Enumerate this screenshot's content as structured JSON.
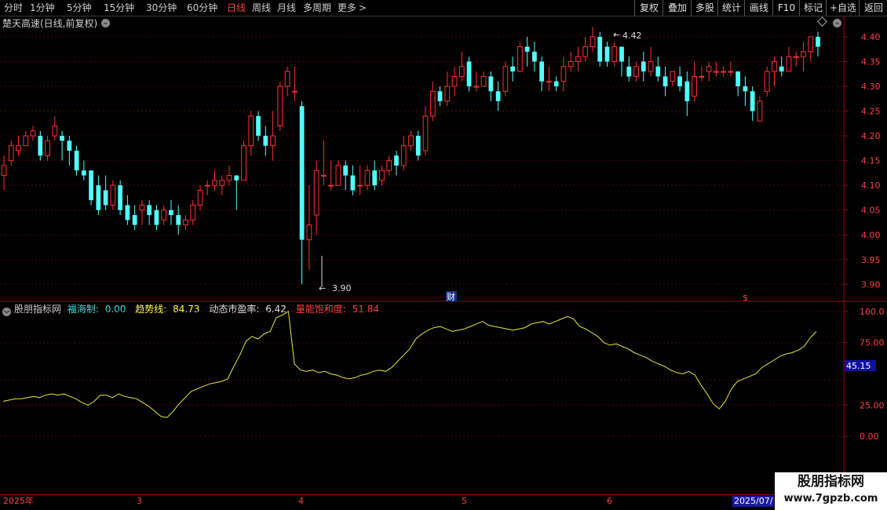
{
  "toolbar": {
    "timeframes": [
      "分时",
      "1分钟",
      "5分钟",
      "15分钟",
      "30分钟",
      "60分钟",
      "日线",
      "周线",
      "月线",
      "多周期",
      "更多"
    ],
    "active_index": 6,
    "right_buttons": [
      "复权",
      "叠加",
      "多股",
      "统计",
      "画线",
      "F10",
      "标记",
      "+自选",
      "返回"
    ]
  },
  "chart": {
    "title": "楚天高速(日线,前复权)",
    "high_label": "4.42",
    "low_label": "3.90",
    "event_label": "财",
    "event2_label": "$",
    "price_ticks": [
      "4.40",
      "4.35",
      "4.30",
      "4.25",
      "4.20",
      "4.15",
      "4.10",
      "4.05",
      "4.00",
      "3.95",
      "3.90"
    ]
  },
  "indicator": {
    "name": "股朋指标网",
    "items": [
      {
        "label": "福海制:",
        "value": "0.00",
        "color": "#40e0e0"
      },
      {
        "label": "趋势线:",
        "value": "84.73",
        "color": "#ffff40"
      },
      {
        "label": "动态市盈率:",
        "value": "6.42",
        "color": "#e0e0e0"
      },
      {
        "label": "量能饱和度:",
        "value": "51.84",
        "color": "#ff4040"
      }
    ],
    "ticks": [
      "100.0",
      "75.00",
      "25.00",
      "0.00"
    ],
    "current_value": "45.15"
  },
  "dates": [
    "2025年",
    "3",
    "4",
    "5",
    "6",
    "2025/07/"
  ],
  "watermark": {
    "line1": "股朋指标网",
    "line2": "www.7gpzb.com"
  },
  "chart_data": {
    "type": "candlestick",
    "ylim": [
      3.88,
      4.43
    ],
    "candles": [
      [
        4.12,
        4.14,
        4.09,
        4.16
      ],
      [
        4.15,
        4.18,
        4.14,
        4.19
      ],
      [
        4.17,
        4.18,
        4.16,
        4.2
      ],
      [
        4.18,
        4.2,
        4.18,
        4.21
      ],
      [
        4.2,
        4.21,
        4.19,
        4.22
      ],
      [
        4.2,
        4.16,
        4.15,
        4.21
      ],
      [
        4.16,
        4.19,
        4.15,
        4.2
      ],
      [
        4.2,
        4.22,
        4.19,
        4.24
      ],
      [
        4.2,
        4.19,
        4.15,
        4.21
      ],
      [
        4.19,
        4.17,
        4.14,
        4.2
      ],
      [
        4.17,
        4.13,
        4.12,
        4.18
      ],
      [
        4.13,
        4.12,
        4.11,
        4.15
      ],
      [
        4.13,
        4.07,
        4.06,
        4.13
      ],
      [
        4.1,
        4.05,
        4.04,
        4.12
      ],
      [
        4.09,
        4.06,
        4.05,
        4.12
      ],
      [
        4.06,
        4.1,
        4.05,
        4.11
      ],
      [
        4.1,
        4.05,
        4.04,
        4.11
      ],
      [
        4.06,
        4.03,
        4.02,
        4.08
      ],
      [
        4.04,
        4.02,
        4.01,
        4.06
      ],
      [
        4.05,
        4.06,
        4.02,
        4.07
      ],
      [
        4.06,
        4.04,
        4.02,
        4.07
      ],
      [
        4.05,
        4.02,
        4.01,
        4.06
      ],
      [
        4.03,
        4.05,
        4.02,
        4.06
      ],
      [
        4.05,
        4.04,
        4.02,
        4.07
      ],
      [
        4.04,
        4.02,
        4.0,
        4.06
      ],
      [
        4.02,
        4.03,
        4.01,
        4.04
      ],
      [
        4.03,
        4.06,
        4.02,
        4.07
      ],
      [
        4.06,
        4.09,
        4.05,
        4.1
      ],
      [
        4.1,
        4.1,
        4.08,
        4.11
      ],
      [
        4.1,
        4.11,
        4.09,
        4.13
      ],
      [
        4.1,
        4.11,
        4.08,
        4.12
      ],
      [
        4.11,
        4.12,
        4.1,
        4.14
      ],
      [
        4.12,
        4.11,
        4.05,
        4.12
      ],
      [
        4.11,
        4.18,
        4.11,
        4.19
      ],
      [
        4.18,
        4.24,
        4.16,
        4.25
      ],
      [
        4.24,
        4.2,
        4.19,
        4.25
      ],
      [
        4.2,
        4.18,
        4.16,
        4.22
      ],
      [
        4.18,
        4.2,
        4.15,
        4.25
      ],
      [
        4.22,
        4.3,
        4.21,
        4.31
      ],
      [
        4.3,
        4.33,
        4.28,
        4.34
      ],
      [
        4.29,
        4.29,
        4.27,
        4.34
      ],
      [
        4.26,
        3.99,
        3.9,
        4.27
      ],
      [
        3.99,
        4.02,
        3.93,
        4.1
      ],
      [
        4.04,
        4.13,
        4.0,
        4.15
      ],
      [
        4.12,
        4.12,
        4.1,
        4.19
      ],
      [
        4.1,
        4.1,
        4.09,
        4.15
      ],
      [
        4.1,
        4.14,
        4.1,
        4.15
      ],
      [
        4.14,
        4.12,
        4.09,
        4.15
      ],
      [
        4.12,
        4.09,
        4.08,
        4.14
      ],
      [
        4.1,
        4.1,
        4.08,
        4.14
      ],
      [
        4.1,
        4.13,
        4.09,
        4.14
      ],
      [
        4.13,
        4.1,
        4.09,
        4.15
      ],
      [
        4.11,
        4.13,
        4.1,
        4.14
      ],
      [
        4.13,
        4.15,
        4.12,
        4.16
      ],
      [
        4.16,
        4.14,
        4.12,
        4.17
      ],
      [
        4.14,
        4.18,
        4.13,
        4.2
      ],
      [
        4.18,
        4.2,
        4.17,
        4.21
      ],
      [
        4.2,
        4.16,
        4.15,
        4.21
      ],
      [
        4.17,
        4.24,
        4.16,
        4.26
      ],
      [
        4.24,
        4.29,
        4.23,
        4.31
      ],
      [
        4.29,
        4.27,
        4.26,
        4.3
      ],
      [
        4.27,
        4.3,
        4.26,
        4.33
      ],
      [
        4.3,
        4.32,
        4.28,
        4.34
      ],
      [
        4.32,
        4.34,
        4.31,
        4.37
      ],
      [
        4.35,
        4.3,
        4.29,
        4.36
      ],
      [
        4.3,
        4.3,
        4.29,
        4.33
      ],
      [
        4.3,
        4.32,
        4.3,
        4.33
      ],
      [
        4.32,
        4.29,
        4.27,
        4.33
      ],
      [
        4.29,
        4.27,
        4.25,
        4.31
      ],
      [
        4.29,
        4.34,
        4.28,
        4.35
      ],
      [
        4.34,
        4.33,
        4.31,
        4.36
      ],
      [
        4.33,
        4.38,
        4.33,
        4.39
      ],
      [
        4.38,
        4.37,
        4.34,
        4.4
      ],
      [
        4.37,
        4.35,
        4.33,
        4.39
      ],
      [
        4.35,
        4.31,
        4.29,
        4.36
      ],
      [
        4.31,
        4.31,
        4.29,
        4.34
      ],
      [
        4.31,
        4.3,
        4.29,
        4.32
      ],
      [
        4.31,
        4.34,
        4.29,
        4.36
      ],
      [
        4.34,
        4.35,
        4.33,
        4.37
      ],
      [
        4.35,
        4.36,
        4.33,
        4.38
      ],
      [
        4.36,
        4.38,
        4.35,
        4.4
      ],
      [
        4.38,
        4.4,
        4.37,
        4.42
      ],
      [
        4.4,
        4.35,
        4.34,
        4.41
      ],
      [
        4.38,
        4.35,
        4.34,
        4.39
      ],
      [
        4.35,
        4.38,
        4.34,
        4.39
      ],
      [
        4.38,
        4.35,
        4.32,
        4.38
      ],
      [
        4.34,
        4.32,
        4.31,
        4.36
      ],
      [
        4.32,
        4.34,
        4.31,
        4.35
      ],
      [
        4.35,
        4.33,
        4.31,
        4.37
      ],
      [
        4.33,
        4.35,
        4.32,
        4.38
      ],
      [
        4.34,
        4.32,
        4.31,
        4.36
      ],
      [
        4.32,
        4.3,
        4.28,
        4.34
      ],
      [
        4.31,
        4.33,
        4.3,
        4.33
      ],
      [
        4.32,
        4.3,
        4.29,
        4.34
      ],
      [
        4.31,
        4.27,
        4.24,
        4.33
      ],
      [
        4.28,
        4.32,
        4.27,
        4.35
      ],
      [
        4.32,
        4.32,
        4.31,
        4.34
      ],
      [
        4.33,
        4.34,
        4.31,
        4.35
      ],
      [
        4.33,
        4.33,
        4.32,
        4.35
      ],
      [
        4.33,
        4.33,
        4.32,
        4.34
      ],
      [
        4.33,
        4.33,
        4.32,
        4.35
      ],
      [
        4.33,
        4.3,
        4.28,
        4.33
      ],
      [
        4.3,
        4.29,
        4.26,
        4.32
      ],
      [
        4.29,
        4.25,
        4.23,
        4.3
      ],
      [
        4.23,
        4.27,
        4.23,
        4.28
      ],
      [
        4.29,
        4.33,
        4.28,
        4.34
      ],
      [
        4.33,
        4.35,
        4.3,
        4.36
      ],
      [
        4.34,
        4.33,
        4.32,
        4.36
      ],
      [
        4.33,
        4.36,
        4.33,
        4.38
      ],
      [
        4.36,
        4.36,
        4.34,
        4.37
      ],
      [
        4.36,
        4.37,
        4.33,
        4.39
      ],
      [
        4.37,
        4.4,
        4.35,
        4.4
      ],
      [
        4.4,
        4.38,
        4.36,
        4.41
      ]
    ],
    "indicator_ylim": [
      -10,
      105
    ],
    "indicator_series": [
      28,
      29,
      30,
      30,
      31,
      32,
      31,
      33,
      34,
      33,
      34,
      32,
      30,
      27,
      25,
      28,
      33,
      33,
      31,
      34,
      32,
      31,
      30,
      27,
      24,
      20,
      16,
      15,
      20,
      26,
      31,
      36,
      38,
      40,
      42,
      43,
      44,
      46,
      56,
      65,
      76,
      80,
      78,
      82,
      84,
      95,
      97,
      100,
      58,
      53,
      52,
      53,
      51,
      52,
      50,
      49,
      47,
      46,
      47,
      49,
      50,
      52,
      53,
      52,
      55,
      60,
      65,
      70,
      78,
      82,
      85,
      87,
      88,
      86,
      84,
      85,
      86,
      88,
      90,
      92,
      89,
      88,
      87,
      86,
      85,
      86,
      87,
      90,
      91,
      92,
      90,
      92,
      94,
      96,
      94,
      88,
      86,
      83,
      80,
      75,
      73,
      74,
      72,
      70,
      67,
      65,
      63,
      60,
      58,
      56,
      53,
      51,
      50,
      52,
      49,
      41,
      34,
      26,
      22,
      28,
      38,
      44,
      46,
      48,
      50,
      55,
      58,
      61,
      64,
      66,
      67,
      69,
      72,
      79,
      84
    ]
  }
}
